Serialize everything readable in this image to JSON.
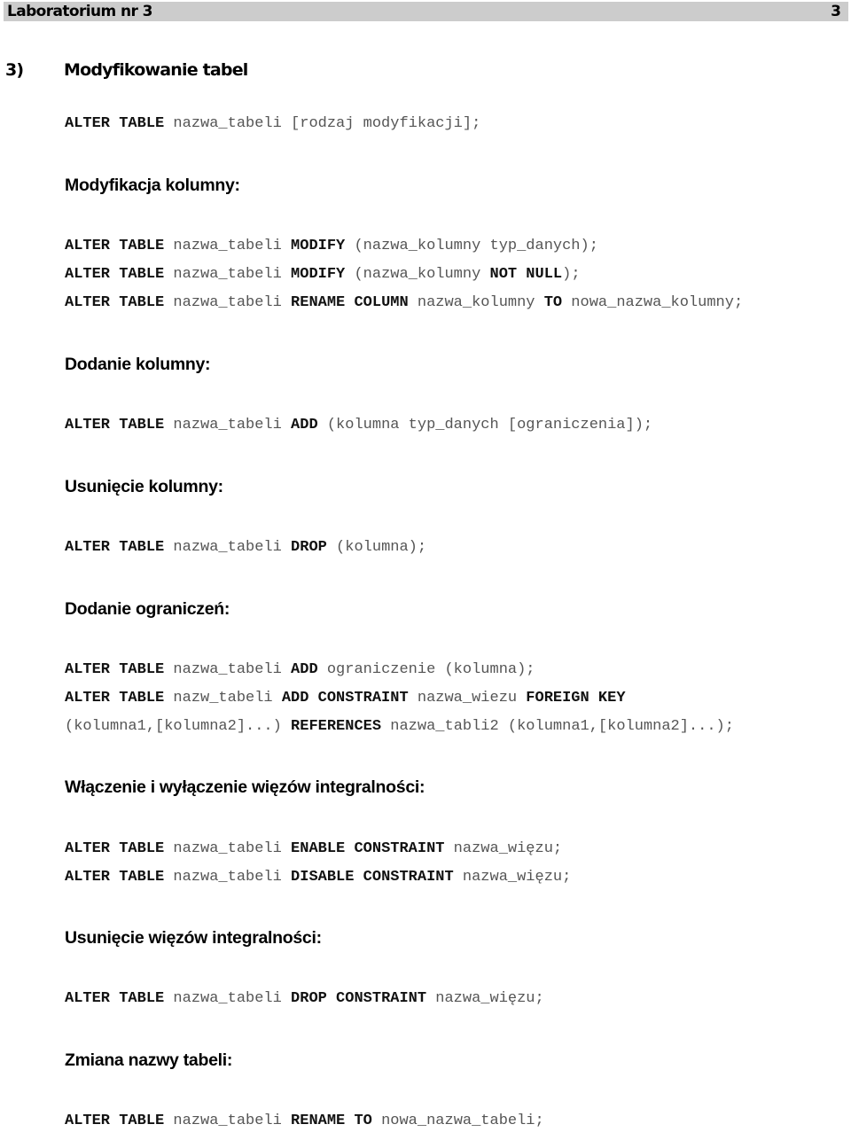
{
  "header": {
    "title": "Laboratorium nr 3",
    "page_number": "3"
  },
  "section": {
    "number": "3)",
    "title": "Modyfikowanie tabel"
  },
  "blocks": [
    {
      "type": "code",
      "segments": [
        {
          "t": "ALTER TABLE",
          "k": true
        },
        {
          "t": " nazwa_tabeli [rodzaj modyfikacji];",
          "k": false
        }
      ]
    },
    {
      "type": "heading",
      "text": "Modyfikacja kolumny:"
    },
    {
      "type": "code",
      "segments": [
        {
          "t": "ALTER TABLE",
          "k": true
        },
        {
          "t": " nazwa_tabeli ",
          "k": false
        },
        {
          "t": "MODIFY",
          "k": true
        },
        {
          "t": " (nazwa_kolumny typ_danych);",
          "k": false
        }
      ]
    },
    {
      "type": "code",
      "segments": [
        {
          "t": "ALTER TABLE",
          "k": true
        },
        {
          "t": " nazwa_tabeli ",
          "k": false
        },
        {
          "t": "MODIFY",
          "k": true
        },
        {
          "t": " (nazwa_kolumny ",
          "k": false
        },
        {
          "t": "NOT NULL",
          "k": true
        },
        {
          "t": ");",
          "k": false
        }
      ]
    },
    {
      "type": "code",
      "segments": [
        {
          "t": "ALTER TABLE",
          "k": true
        },
        {
          "t": " nazwa_tabeli ",
          "k": false
        },
        {
          "t": "RENAME COLUMN",
          "k": true
        },
        {
          "t": " nazwa_kolumny ",
          "k": false
        },
        {
          "t": "TO",
          "k": true
        },
        {
          "t": " nowa_nazwa_kolumny;",
          "k": false
        }
      ]
    },
    {
      "type": "heading",
      "text": "Dodanie kolumny:"
    },
    {
      "type": "code",
      "segments": [
        {
          "t": "ALTER TABLE",
          "k": true
        },
        {
          "t": " nazwa_tabeli ",
          "k": false
        },
        {
          "t": "ADD",
          "k": true
        },
        {
          "t": " (kolumna typ_danych [ograniczenia]);",
          "k": false
        }
      ]
    },
    {
      "type": "heading",
      "text": "Usunięcie kolumny:"
    },
    {
      "type": "code",
      "segments": [
        {
          "t": "ALTER TABLE",
          "k": true
        },
        {
          "t": " nazwa_tabeli ",
          "k": false
        },
        {
          "t": "DROP",
          "k": true
        },
        {
          "t": " (kolumna);",
          "k": false
        }
      ]
    },
    {
      "type": "heading",
      "text": "Dodanie ograniczeń:"
    },
    {
      "type": "code",
      "segments": [
        {
          "t": "ALTER TABLE",
          "k": true
        },
        {
          "t": " nazwa_tabeli ",
          "k": false
        },
        {
          "t": "ADD",
          "k": true
        },
        {
          "t": " ograniczenie (kolumna);",
          "k": false
        }
      ]
    },
    {
      "type": "code",
      "segments": [
        {
          "t": "ALTER TABLE",
          "k": true
        },
        {
          "t": " nazw_tabeli ",
          "k": false
        },
        {
          "t": "ADD CONSTRAINT",
          "k": true
        },
        {
          "t": " nazwa_wiezu ",
          "k": false
        },
        {
          "t": "FOREIGN KEY",
          "k": true
        }
      ]
    },
    {
      "type": "code",
      "segments": [
        {
          "t": "(kolumna1,[kolumna2]...) ",
          "k": false
        },
        {
          "t": "REFERENCES",
          "k": true
        },
        {
          "t": " nazwa_tabli2 (kolumna1,[kolumna2]...);",
          "k": false
        }
      ]
    },
    {
      "type": "heading",
      "text": "Włączenie i wyłączenie więzów integralności:"
    },
    {
      "type": "code",
      "segments": [
        {
          "t": "ALTER TABLE",
          "k": true
        },
        {
          "t": " nazwa_tabeli ",
          "k": false
        },
        {
          "t": "ENABLE CONSTRAINT",
          "k": true
        },
        {
          "t": " nazwa_więzu;",
          "k": false
        }
      ]
    },
    {
      "type": "code",
      "segments": [
        {
          "t": "ALTER TABLE",
          "k": true
        },
        {
          "t": " nazwa_tabeli ",
          "k": false
        },
        {
          "t": "DISABLE CONSTRAINT",
          "k": true
        },
        {
          "t": " nazwa_więzu;",
          "k": false
        }
      ]
    },
    {
      "type": "heading",
      "text": "Usunięcie więzów integralności:"
    },
    {
      "type": "code",
      "segments": [
        {
          "t": "ALTER TABLE",
          "k": true
        },
        {
          "t": " nazwa_tabeli ",
          "k": false
        },
        {
          "t": "DROP CONSTRAINT",
          "k": true
        },
        {
          "t": " nazwa_więzu;",
          "k": false
        }
      ]
    },
    {
      "type": "heading",
      "text": "Zmiana nazwy tabeli:"
    },
    {
      "type": "code",
      "segments": [
        {
          "t": "ALTER TABLE",
          "k": true
        },
        {
          "t": " nazwa_tabeli ",
          "k": false
        },
        {
          "t": "RENAME TO",
          "k": true
        },
        {
          "t": " nowa_nazwa_tabeli;",
          "k": false
        }
      ]
    }
  ]
}
